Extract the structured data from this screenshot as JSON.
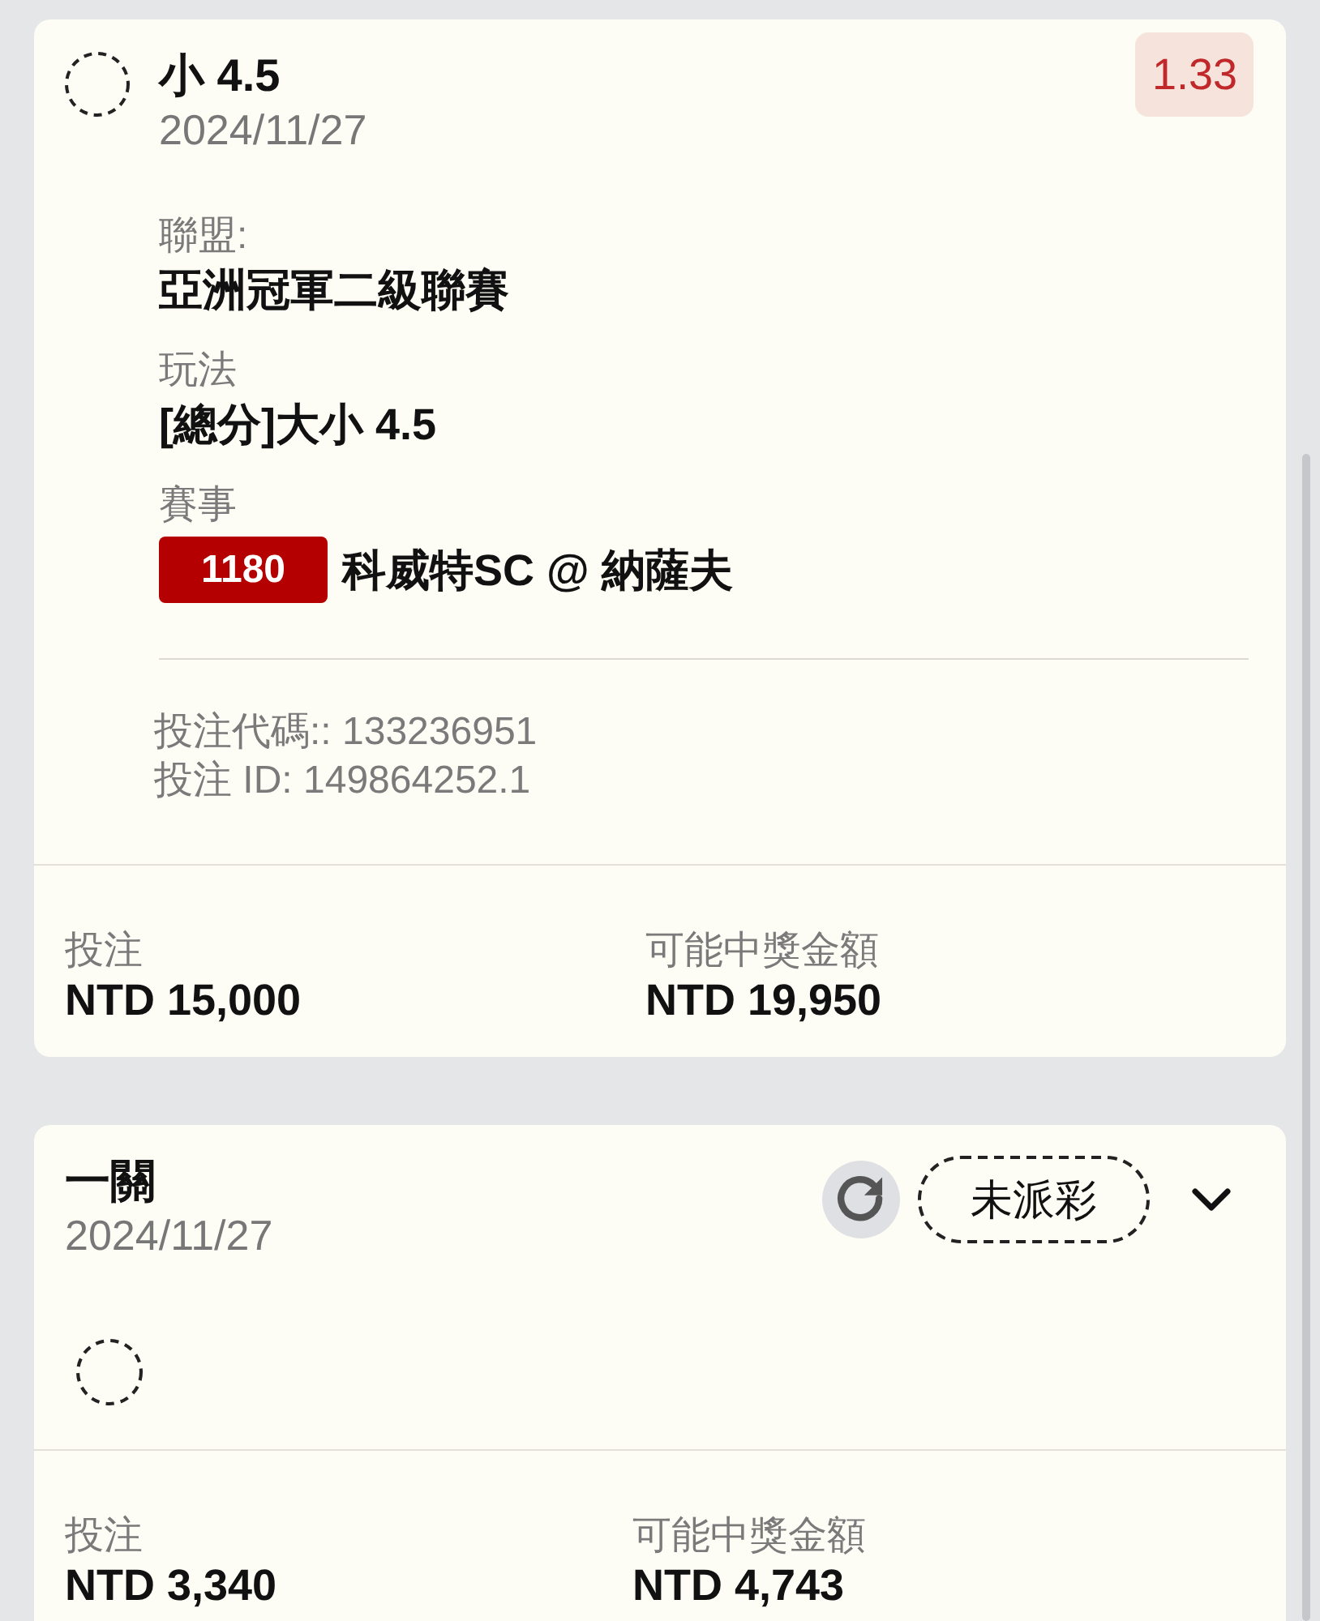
{
  "bets": [
    {
      "kind": "leg",
      "title": "小 4.5",
      "date": "2024/11/27",
      "odds": "1.33",
      "details": [
        {
          "kind": "text",
          "label": "聯盟:",
          "value": "亞洲冠軍二級聯賽"
        },
        {
          "kind": "text",
          "label": "玩法",
          "value": "[總分]大小 4.5"
        },
        {
          "kind": "match",
          "label": "賽事",
          "match_code": "1180",
          "value": "科威特SC @ 納薩夫"
        }
      ],
      "codes": [
        "投注代碼:: 133236951",
        "投注 ID: 149864252.1"
      ],
      "stake": {
        "label": "投注",
        "value": "NTD 15,000"
      },
      "payout": {
        "label": "可能中獎金額",
        "value": "NTD 19,950"
      }
    },
    {
      "kind": "parlay",
      "title": "一關",
      "date": "2024/11/27",
      "status": "未派彩",
      "expanded": false,
      "stake": {
        "label": "投注",
        "value": "NTD 3,340"
      },
      "payout": {
        "label": "可能中獎金額",
        "value": "NTD 4,743"
      }
    }
  ]
}
